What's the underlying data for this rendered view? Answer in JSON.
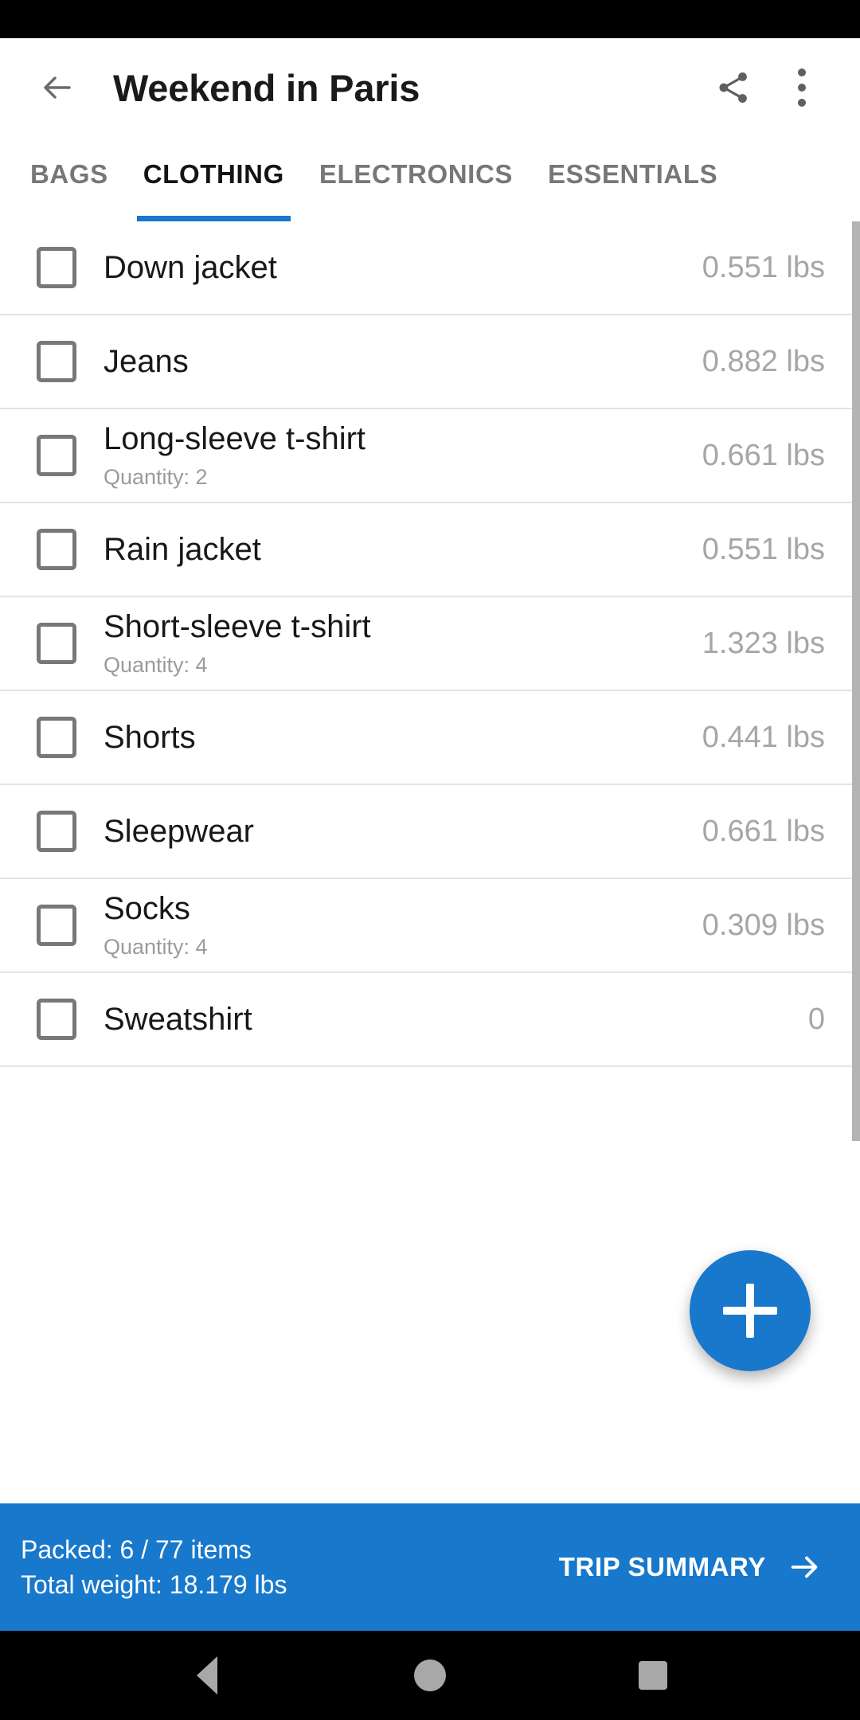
{
  "app": {
    "toolbar": {
      "back_icon": "arrow-left-icon",
      "title": "Weekend in Paris",
      "share_icon": "share-icon",
      "overflow_icon": "more-vertical-icon"
    },
    "tabs": [
      {
        "label": "BAGS",
        "active": false
      },
      {
        "label": "CLOTHING",
        "active": true
      },
      {
        "label": "ELECTRONICS",
        "active": false
      },
      {
        "label": "ESSENTIALS",
        "active": false
      }
    ],
    "list": {
      "items": [
        {
          "name": "Down jacket",
          "subtitle": "",
          "weight": "0.551 lbs",
          "checked": false
        },
        {
          "name": "Jeans",
          "subtitle": "",
          "weight": "0.882 lbs",
          "checked": false
        },
        {
          "name": "Long-sleeve t-shirt",
          "subtitle": "Quantity: 2",
          "weight": "0.661 lbs",
          "checked": false
        },
        {
          "name": "Rain jacket",
          "subtitle": "",
          "weight": "0.551 lbs",
          "checked": false
        },
        {
          "name": "Short-sleeve t-shirt",
          "subtitle": "Quantity: 4",
          "weight": "1.323 lbs",
          "checked": false
        },
        {
          "name": "Shorts",
          "subtitle": "",
          "weight": "0.441 lbs",
          "checked": false
        },
        {
          "name": "Sleepwear",
          "subtitle": "",
          "weight": "0.661 lbs",
          "checked": false
        },
        {
          "name": "Socks",
          "subtitle": "Quantity: 4",
          "weight": "0.309 lbs",
          "checked": false
        },
        {
          "name": "Sweatshirt",
          "subtitle": "",
          "weight": "0",
          "checked": false
        }
      ]
    },
    "fab": {
      "icon": "plus-icon"
    },
    "bottom_bar": {
      "packed_line": "Packed: 6 / 77 items",
      "weight_line": "Total weight: 18.179 lbs",
      "action_label": "TRIP SUMMARY",
      "action_icon": "arrow-right-icon"
    },
    "nav_bar": {
      "back": "triangle-back-icon",
      "home": "circle-home-icon",
      "recents": "square-recents-icon"
    },
    "colors": {
      "accent": "#1878cc",
      "bar_background": "#1878cc",
      "text_primary": "#181818",
      "text_secondary": "#a6a6a6"
    }
  }
}
